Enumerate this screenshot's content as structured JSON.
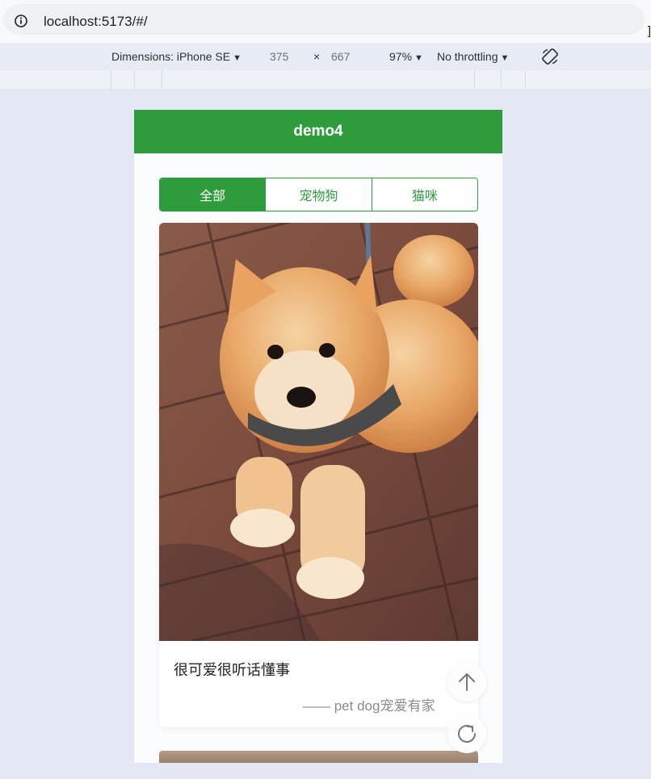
{
  "browser": {
    "url": "localhost:5173/#/",
    "edge_glyph": "]"
  },
  "devtools": {
    "dimensions_label": "Dimensions: iPhone SE",
    "width": "375",
    "times": "×",
    "height": "667",
    "zoom": "97%",
    "throttling": "No throttling"
  },
  "app": {
    "header_title": "demo4",
    "tabs": [
      {
        "label": "全部",
        "active": true
      },
      {
        "label": "宠物狗",
        "active": false
      },
      {
        "label": "猫咪",
        "active": false
      }
    ],
    "cards": [
      {
        "title": "很可爱很听话懂事",
        "subtitle": "—— pet dog宠爱有家"
      }
    ]
  },
  "colors": {
    "accent": "#2e9c3c",
    "page_bg": "#e4e8f4"
  },
  "icons": {
    "info": "info-icon",
    "rotate": "rotate-icon",
    "back_to_top": "arrow-up-icon",
    "refresh": "refresh-icon"
  }
}
